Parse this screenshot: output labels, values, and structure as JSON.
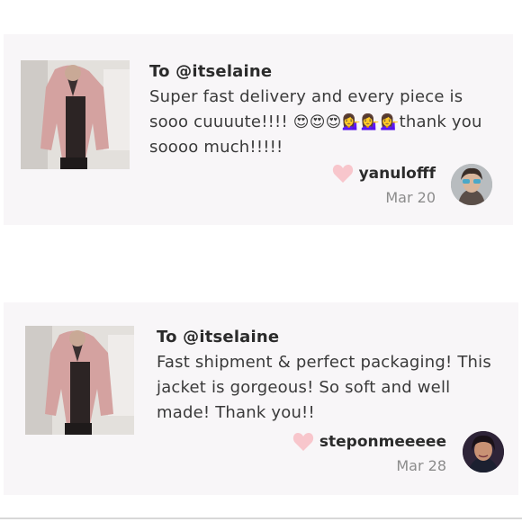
{
  "reviews": [
    {
      "recipient": "To @itselaine",
      "text_before_emoji": "Super fast delivery and every piece is sooo cuuuute!!!! ",
      "emojis": "😍😍😍💁‍♀️💁‍♀️💁‍♀️",
      "text_after_emoji": "thank you soooo much!!!!!",
      "username": "yanulofff",
      "date": "Mar 20",
      "thumbnail_icon": "pink-jacket-photo",
      "avatar_icon": "user-avatar-sunglasses"
    },
    {
      "recipient": "To @itselaine",
      "text": "Fast shipment & perfect packaging! This jacket is gorgeous! So soft and well made! Thank you!!",
      "username": "steponmeeeee",
      "date": "Mar 28",
      "thumbnail_icon": "pink-jacket-photo",
      "avatar_icon": "user-avatar-selfie"
    }
  ],
  "colors": {
    "card_bg": "#f8f6f8",
    "heart": "#f8c6cc",
    "date": "#8c8c8c",
    "text": "#2b2b2b"
  }
}
